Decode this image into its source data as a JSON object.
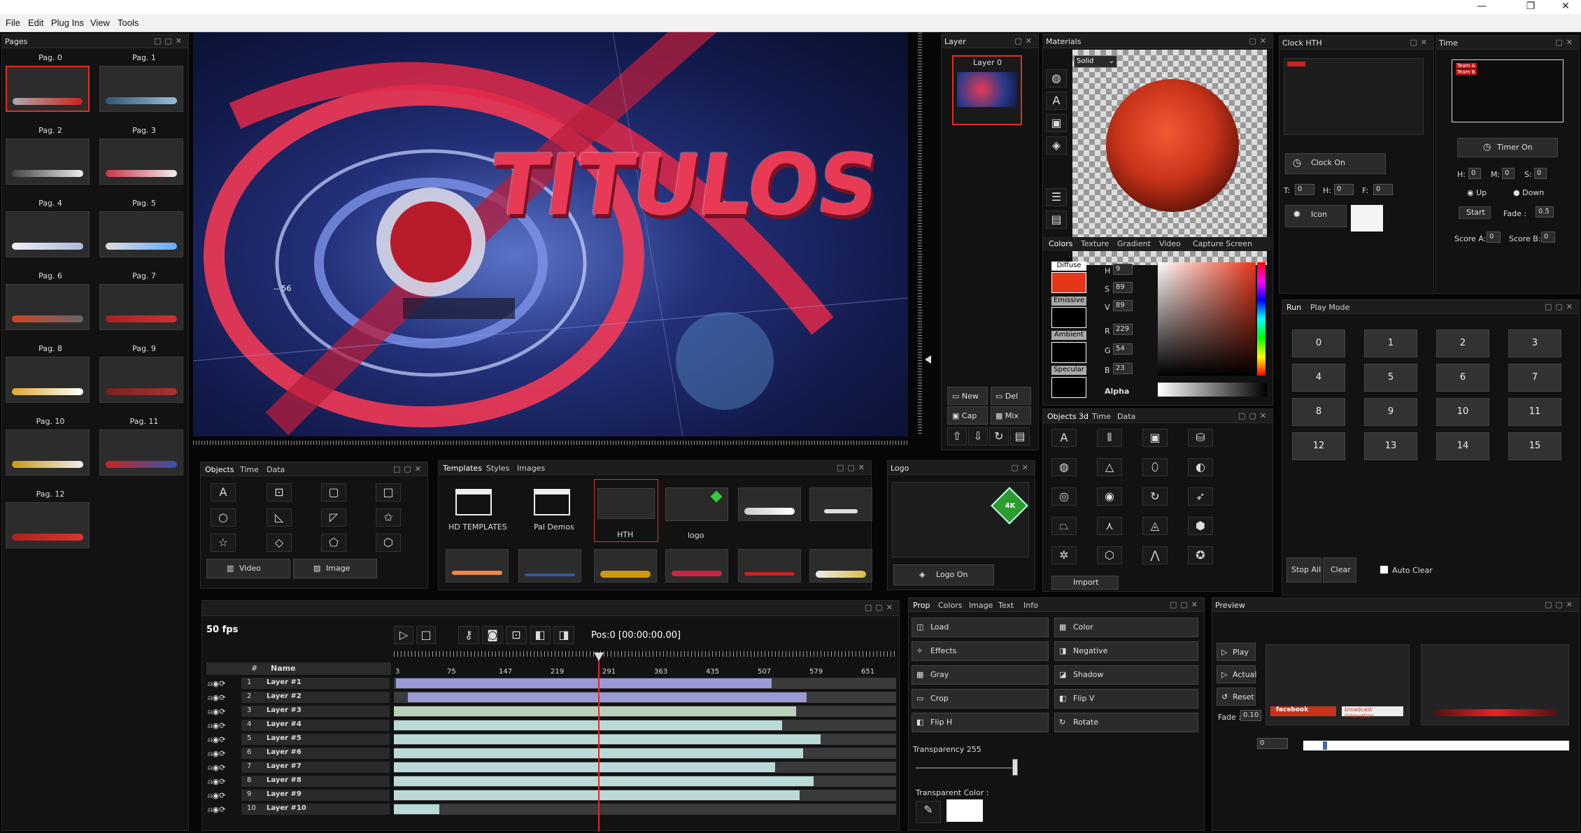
{
  "window": {
    "min": "—",
    "max": "❐",
    "close": "✕"
  },
  "menu": [
    "File",
    "Edit",
    "Plug Ins",
    "View",
    "Tools"
  ],
  "pages": {
    "title": "Pages",
    "items": [
      "Pag. 0",
      "Pag. 1",
      "Pag. 2",
      "Pag. 3",
      "Pag. 4",
      "Pag. 5",
      "Pag. 6",
      "Pag. 7",
      "Pag. 8",
      "Pag. 9",
      "Pag. 10",
      "Pag. 11",
      "Pag. 12"
    ],
    "selected": "Pag. 0"
  },
  "preview_main": {
    "title_text": "TITULOS",
    "side_text": "-- 56"
  },
  "layer": {
    "title": "Layer",
    "item": "Layer 0",
    "new": "New",
    "del": "Del",
    "cap": "Cap",
    "mix": "Mix"
  },
  "materials": {
    "title": "Materials",
    "mode": "Solid",
    "tabs": [
      "Colors",
      "Texture",
      "Gradient",
      "Video",
      "Capture Screen"
    ],
    "diffuse": "Diffuse",
    "emissive": "Emissive",
    "ambient": "Ambient",
    "specular": "Specular",
    "h_label": "H",
    "h": "9",
    "s_label": "S",
    "s": "89",
    "v_label": "V",
    "v": "89",
    "r_label": "R",
    "r": "229",
    "g_label": "G",
    "g": "54",
    "b_label": "B",
    "b": "23",
    "alpha": "Alpha",
    "color_diffuse": "#e5361a"
  },
  "clock": {
    "title": "Clock HTH",
    "clock_on": "Clock On",
    "icon": "Icon",
    "t": "T:",
    "h": "H:",
    "f": "F:",
    "t_val": "0",
    "h_val": "0",
    "f_val": "0"
  },
  "time": {
    "title": "Time",
    "team_a": "Team A",
    "team_b": "Team B",
    "timer_on": "Timer On",
    "h": "H:",
    "m": "M:",
    "s": "S:",
    "h_val": "0",
    "m_val": "0",
    "s_val": "0",
    "up": "Up",
    "down": "Down",
    "start": "Start",
    "fade": "Fade :",
    "fade_val": "0.5",
    "score_a": "Score A:",
    "score_a_val": "0",
    "score_b": "Score B:",
    "score_b_val": "0"
  },
  "run": {
    "tabs": [
      "Run",
      "Play Mode"
    ],
    "numbers": [
      "0",
      "1",
      "2",
      "3",
      "4",
      "5",
      "6",
      "7",
      "8",
      "9",
      "10",
      "11",
      "12",
      "13",
      "14",
      "15"
    ],
    "stop_all": "Stop All",
    "clear": "Clear",
    "auto_clear": "Auto Clear"
  },
  "objects": {
    "tabs": [
      "Objects",
      "Time",
      "Data"
    ],
    "video": "Video",
    "image": "Image"
  },
  "templates": {
    "tabs": [
      "Templates",
      "Styles",
      "Images"
    ],
    "folders": [
      "HD TEMPLATES",
      "Pal Demos"
    ],
    "items": [
      "HTH",
      "logo"
    ]
  },
  "logo": {
    "title": "Logo",
    "badge": "4K",
    "logo_on": "Logo On"
  },
  "objects3d": {
    "tabs": [
      "Objects 3d",
      "Time",
      "Data"
    ],
    "import": "Import"
  },
  "timeline": {
    "fps": "50 fps",
    "pos": "Pos:0 [00:00:00.00]",
    "col_num": "#",
    "col_name": "Name",
    "ticks": [
      "3",
      "75",
      "147",
      "219",
      "291",
      "363",
      "435",
      "507",
      "579",
      "651"
    ],
    "layers": [
      {
        "n": "1",
        "name": "Layer #1",
        "start": 3,
        "end": 540
      },
      {
        "n": "2",
        "name": "Layer #2",
        "start": 20,
        "end": 590
      },
      {
        "n": "3",
        "name": "Layer #3",
        "start": 0,
        "end": 575
      },
      {
        "n": "4",
        "name": "Layer #4",
        "start": 0,
        "end": 555
      },
      {
        "n": "5",
        "name": "Layer #5",
        "start": 0,
        "end": 610
      },
      {
        "n": "6",
        "name": "Layer #6",
        "start": 0,
        "end": 585
      },
      {
        "n": "7",
        "name": "Layer #7",
        "start": 0,
        "end": 545
      },
      {
        "n": "8",
        "name": "Layer #8",
        "start": 0,
        "end": 600
      },
      {
        "n": "9",
        "name": "Layer #9",
        "start": 0,
        "end": 580
      },
      {
        "n": "10",
        "name": "Layer #10",
        "start": 0,
        "end": 65
      }
    ]
  },
  "prop": {
    "tabs": [
      "Prop",
      "Colors",
      "Image",
      "Text",
      "Info"
    ],
    "left": [
      "Load",
      "Effects",
      "Gray",
      "Crop",
      "Flip H"
    ],
    "right": [
      "Color",
      "Negative",
      "Shadow",
      "Flip V",
      "Rotate"
    ],
    "transparency": "Transparency",
    "transparency_val": "255",
    "transparent_color": "Transparent Color :"
  },
  "preview": {
    "title": "Preview",
    "play": "Play",
    "actual": "Actual",
    "reset": "Reset",
    "fade": "Fade :",
    "fade_val": "0.10",
    "counter": "0",
    "banner_left": "facebook",
    "banner_right": "broadcast innovation"
  }
}
